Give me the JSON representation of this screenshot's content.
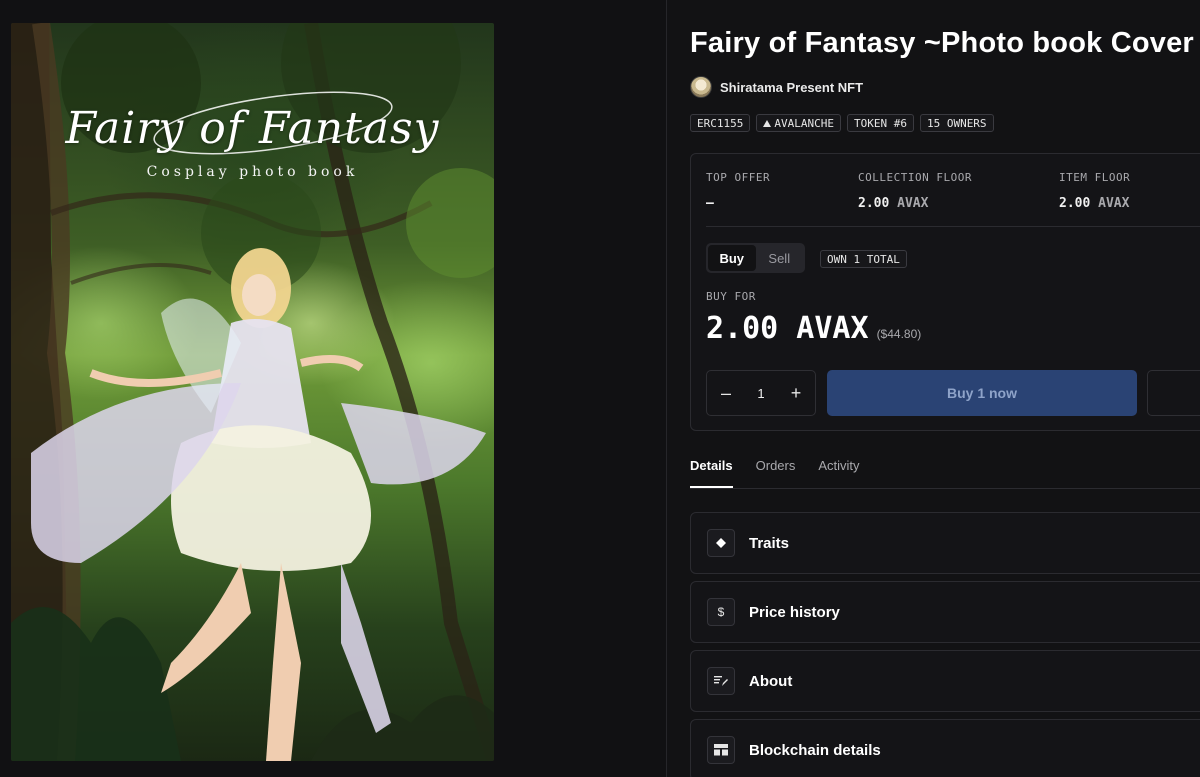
{
  "artwork": {
    "title": "Fairy of Fantasy",
    "subtitle": "Cosplay photo book"
  },
  "item": {
    "title": "Fairy of Fantasy ~Photo book Cover",
    "creator": "Shiratama Present NFT",
    "badges": [
      "ERC1155",
      "AVALANCHE",
      "TOKEN #6",
      "15 OWNERS"
    ]
  },
  "stats": {
    "top_offer_label": "TOP OFFER",
    "top_offer_value": "–",
    "collection_floor_label": "COLLECTION FLOOR",
    "collection_floor_value": "2.00",
    "collection_floor_unit": "AVAX",
    "item_floor_label": "ITEM FLOOR",
    "item_floor_value": "2.00",
    "item_floor_unit": "AVAX"
  },
  "trade": {
    "toggle_buy": "Buy",
    "toggle_sell": "Sell",
    "own_badge": "OWN 1 TOTAL",
    "buy_for_label": "BUY FOR",
    "price": "2.00 AVAX",
    "price_usd": "($44.80)",
    "qty_minus": "–",
    "qty_value": "1",
    "qty_plus": "+",
    "buy_button": "Buy 1 now"
  },
  "tabs": [
    "Details",
    "Orders",
    "Activity"
  ],
  "sections": {
    "traits": "Traits",
    "price_history": "Price history",
    "about": "About",
    "blockchain": "Blockchain details"
  },
  "icons": {
    "traits": "diamond-icon",
    "price_history": "dollar-icon",
    "about": "text-edit-icon",
    "blockchain": "table-icon"
  },
  "colors": {
    "background": "#121214",
    "buy_button": "#2a4374",
    "buy_button_text": "#8ea3c9"
  }
}
